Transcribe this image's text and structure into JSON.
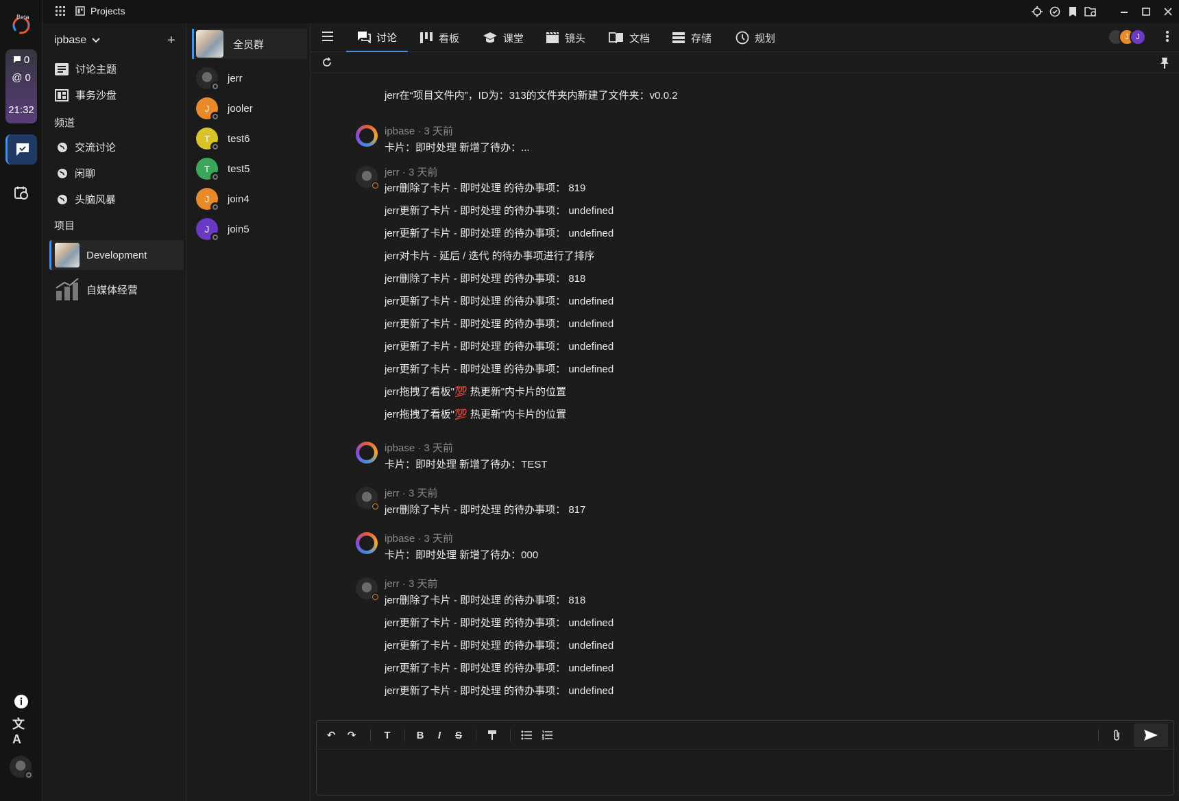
{
  "app": {
    "title": "Projects",
    "beta_label": "Beta"
  },
  "rail": {
    "messages_count": "0",
    "mentions_count": "0",
    "time": "21:32"
  },
  "workspace": {
    "name": "ipbase",
    "items": [
      {
        "label": "讨论主题"
      },
      {
        "label": "事务沙盘"
      }
    ],
    "channels_heading": "频道",
    "channels": [
      {
        "label": "交流讨论"
      },
      {
        "label": "闲聊"
      },
      {
        "label": "头脑风暴"
      }
    ],
    "projects_heading": "项目",
    "projects": [
      {
        "label": "Development"
      },
      {
        "label": "自媒体经营"
      }
    ]
  },
  "members": [
    {
      "label": "全员群"
    },
    {
      "label": "jerr",
      "color": "#2a2a2a"
    },
    {
      "label": "jooler",
      "initial": "J",
      "color": "#e8892a"
    },
    {
      "label": "test6",
      "initial": "T",
      "color": "#d9c22a"
    },
    {
      "label": "test5",
      "initial": "T",
      "color": "#3aa65a"
    },
    {
      "label": "join4",
      "initial": "J",
      "color": "#e8892a"
    },
    {
      "label": "join5",
      "initial": "J",
      "color": "#6a3ac2"
    }
  ],
  "tabs": [
    {
      "label": "讨论"
    },
    {
      "label": "看板"
    },
    {
      "label": "课堂"
    },
    {
      "label": "镜头"
    },
    {
      "label": "文档"
    },
    {
      "label": "存储"
    },
    {
      "label": "规划"
    }
  ],
  "header_avatars": [
    {
      "initial": "J"
    },
    {
      "initial": "J"
    }
  ],
  "messages": {
    "system": "jerr在“项目文件内”，ID为：313的文件夹内新建了文件夹：v0.0.2",
    "groups": [
      {
        "meta": "ipbase · 3 天前",
        "lines": [
          "卡片：即时处理 新增了待办：..."
        ]
      },
      {
        "meta": "jerr · 3 天前",
        "lines": [
          "jerr删除了卡片 - 即时处理 的待办事项： 819",
          "jerr更新了卡片 - 即时处理 的待办事项： undefined",
          "jerr更新了卡片 - 即时处理 的待办事项： undefined",
          "jerr对卡片 - 延后 / 迭代 的待办事项进行了排序",
          "jerr删除了卡片 - 即时处理 的待办事项： 818",
          "jerr更新了卡片 - 即时处理 的待办事项： undefined",
          "jerr更新了卡片 - 即时处理 的待办事项： undefined",
          "jerr更新了卡片 - 即时处理 的待办事项： undefined",
          "jerr更新了卡片 - 即时处理 的待办事项： undefined",
          "jerr拖拽了看板\"💯 热更新\"内卡片的位置",
          "jerr拖拽了看板\"💯 热更新\"内卡片的位置"
        ]
      },
      {
        "meta": "ipbase · 3 天前",
        "lines": [
          "卡片：即时处理 新增了待办：TEST"
        ]
      },
      {
        "meta": "jerr · 3 天前",
        "lines": [
          "jerr删除了卡片 - 即时处理 的待办事项： 817"
        ]
      },
      {
        "meta": "ipbase · 3 天前",
        "lines": [
          "卡片：即时处理 新增了待办：000"
        ]
      },
      {
        "meta": "jerr · 3 天前",
        "lines": [
          "jerr删除了卡片 - 即时处理 的待办事项： 818",
          "jerr更新了卡片 - 即时处理 的待办事项： undefined",
          "jerr更新了卡片 - 即时处理 的待办事项： undefined",
          "jerr更新了卡片 - 即时处理 的待办事项： undefined",
          "jerr更新了卡片 - 即时处理 的待办事项： undefined"
        ]
      }
    ]
  },
  "composer": {
    "value": ""
  }
}
